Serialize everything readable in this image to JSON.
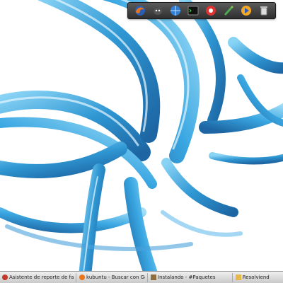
{
  "dock": {
    "items": [
      {
        "name": "Firefox",
        "icon": "firefox-icon"
      },
      {
        "name": "Pidgin",
        "icon": "pidgin-icon"
      },
      {
        "name": "Browser",
        "icon": "globe-icon"
      },
      {
        "name": "Terminal",
        "icon": "terminal-icon"
      },
      {
        "name": "Media",
        "icon": "media-icon"
      },
      {
        "name": "Editor",
        "icon": "editor-icon"
      },
      {
        "name": "Player",
        "icon": "player-icon"
      },
      {
        "name": "Trash",
        "icon": "trash-icon"
      }
    ]
  },
  "taskbar": {
    "tasks": [
      {
        "label": "Asistente de reporte de fall",
        "icon": "bug-icon"
      },
      {
        "label": "kubuntu - Buscar con Goo",
        "icon": "firefox-icon"
      },
      {
        "label": "Instalando - #Paquetes",
        "icon": "package-icon"
      },
      {
        "label": "Resolviend",
        "icon": "folder-icon"
      }
    ]
  },
  "colors": {
    "glass_blue": "#1e8fd0",
    "glass_dark": "#0a5a9c",
    "glass_light": "#7fd0f5"
  }
}
